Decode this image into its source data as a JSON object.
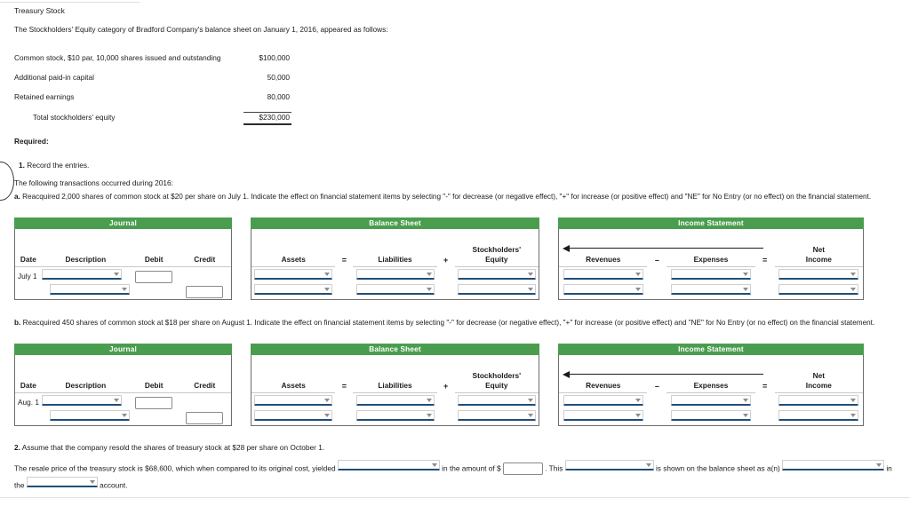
{
  "document": {
    "title": "Treasury Stock",
    "intro": "The Stockholders' Equity category of Bradford Company's balance sheet on January 1, 2016, appeared as follows:"
  },
  "equity_table": {
    "rows": [
      {
        "label": "Common stock, $10 par, 10,000 shares issued and outstanding",
        "amount": "$100,000",
        "indent": false,
        "rule_above": false,
        "double_rule": false
      },
      {
        "label": "Additional paid-in capital",
        "amount": "50,000",
        "indent": false,
        "rule_above": false,
        "double_rule": false
      },
      {
        "label": "Retained earnings",
        "amount": "80,000",
        "indent": false,
        "rule_above": false,
        "double_rule": false
      },
      {
        "label": "Total stockholders' equity",
        "amount": "$230,000",
        "indent": true,
        "rule_above": true,
        "double_rule": true
      }
    ]
  },
  "required": {
    "heading": "Required:",
    "item1_number": "1.",
    "item1_text": "Record the entries.",
    "transactions_note": "The following transactions occurred during 2016:",
    "part_a": {
      "letter": "a.",
      "text": "Reacquired 2,000 shares of common stock at $20 per share on July 1. Indicate the effect on financial statement items by selecting \"-\" for decrease (or negative effect), \"+\" for increase (or positive effect) and \"NE\" for No Entry (or no effect) on the financial statement."
    },
    "part_b": {
      "letter": "b.",
      "text": "Reacquired 450 shares of common stock at $18 per share on August 1. Indicate the effect on financial statement items by selecting \"-\" for decrease (or negative effect), \"+\" for increase (or positive effect) and \"NE\" for No Entry (or no effect) on the financial statement."
    },
    "item2_number": "2.",
    "item2_text": "Assume that the company resold the shares of treasury stock at $28 per share on October 1."
  },
  "grids": [
    {
      "id": "grid-a",
      "banners": {
        "journal": "Journal",
        "balance_sheet": "Balance Sheet",
        "income_statement": "Income Statement"
      },
      "journal_headers": [
        "Date",
        "Description",
        "Debit",
        "Credit"
      ],
      "balance_sheet_headers": [
        {
          "label": "Assets",
          "super": ""
        },
        {
          "label": "=",
          "super": "",
          "operator": true
        },
        {
          "label": "Liabilities",
          "super": ""
        },
        {
          "label": "+",
          "super": "",
          "operator": true
        },
        {
          "label": "Equity",
          "super": "Stockholders'"
        }
      ],
      "income_statement_headers": [
        {
          "label": "Revenues",
          "super": ""
        },
        {
          "label": "–",
          "super": "",
          "operator": true
        },
        {
          "label": "Expenses",
          "super": ""
        },
        {
          "label": "=",
          "super": "",
          "operator": true
        },
        {
          "label": "Income",
          "super": "Net"
        }
      ],
      "rows": [
        {
          "date": "July 1",
          "description": "",
          "debit": "",
          "credit": "",
          "debit_enabled": true,
          "credit_enabled": false,
          "assets": "",
          "liabilities": "",
          "equity": "",
          "revenues": "",
          "expenses": "",
          "net_income": ""
        },
        {
          "date": "",
          "description": "",
          "debit": "",
          "credit": "",
          "debit_enabled": false,
          "credit_enabled": true,
          "assets": "",
          "liabilities": "",
          "equity": "",
          "revenues": "",
          "expenses": "",
          "net_income": ""
        }
      ]
    },
    {
      "id": "grid-b",
      "banners": {
        "journal": "Journal",
        "balance_sheet": "Balance Sheet",
        "income_statement": "Income Statement"
      },
      "journal_headers": [
        "Date",
        "Description",
        "Debit",
        "Credit"
      ],
      "balance_sheet_headers": [
        {
          "label": "Assets",
          "super": ""
        },
        {
          "label": "=",
          "super": "",
          "operator": true
        },
        {
          "label": "Liabilities",
          "super": ""
        },
        {
          "label": "+",
          "super": "",
          "operator": true
        },
        {
          "label": "Equity",
          "super": "Stockholders'"
        }
      ],
      "income_statement_headers": [
        {
          "label": "Revenues",
          "super": ""
        },
        {
          "label": "–",
          "super": "",
          "operator": true
        },
        {
          "label": "Expenses",
          "super": ""
        },
        {
          "label": "=",
          "super": "",
          "operator": true
        },
        {
          "label": "Income",
          "super": "Net"
        }
      ],
      "rows": [
        {
          "date": "Aug. 1",
          "description": "",
          "debit": "",
          "credit": "",
          "debit_enabled": true,
          "credit_enabled": false,
          "assets": "",
          "liabilities": "",
          "equity": "",
          "revenues": "",
          "expenses": "",
          "net_income": ""
        },
        {
          "date": "",
          "description": "",
          "debit": "",
          "credit": "",
          "debit_enabled": false,
          "credit_enabled": true,
          "assets": "",
          "liabilities": "",
          "equity": "",
          "revenues": "",
          "expenses": "",
          "net_income": ""
        }
      ]
    }
  ],
  "part2_sentence": {
    "seg1": "The resale price of the treasury stock is $68,600, which when compared to its original cost, yielded",
    "seg2": "in the amount of $",
    "seg3": ". This",
    "seg4": "is shown on the balance sheet as a(n)",
    "seg5": "in",
    "seg6": "the",
    "seg7": "account.",
    "blank1_value": "",
    "amount_value": "",
    "blank2_value": "",
    "blank3_value": "",
    "blank4_value": ""
  },
  "colors": {
    "banner_green": "#4a9d4e",
    "select_underline": "#1f4e79",
    "text": "#1b1b1b"
  }
}
